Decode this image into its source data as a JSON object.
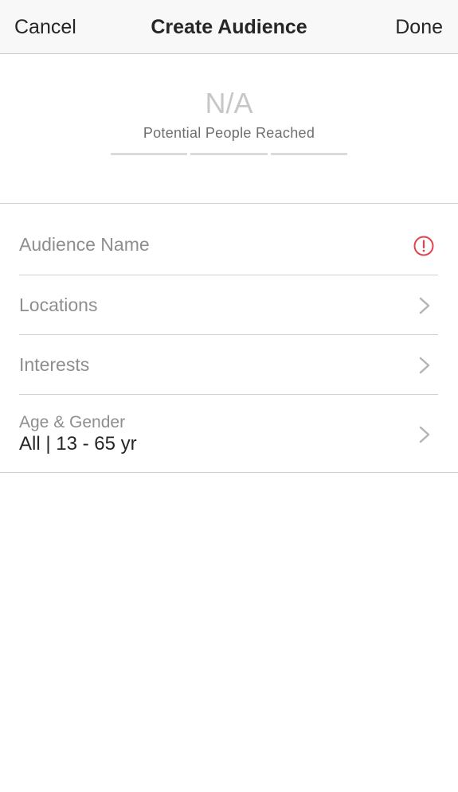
{
  "navbar": {
    "cancel_label": "Cancel",
    "title": "Create Audience",
    "done_label": "Done"
  },
  "reach": {
    "value": "N/A",
    "label": "Potential People Reached"
  },
  "form": {
    "audience_name": {
      "label": "Audience Name",
      "icon": "alert-circle-icon",
      "icon_color": "#e0454c"
    },
    "locations": {
      "label": "Locations",
      "icon": "chevron-right-icon"
    },
    "interests": {
      "label": "Interests",
      "icon": "chevron-right-icon"
    },
    "age_gender": {
      "label": "Age & Gender",
      "value": "All | 13 - 65 yr",
      "icon": "chevron-right-icon"
    }
  }
}
